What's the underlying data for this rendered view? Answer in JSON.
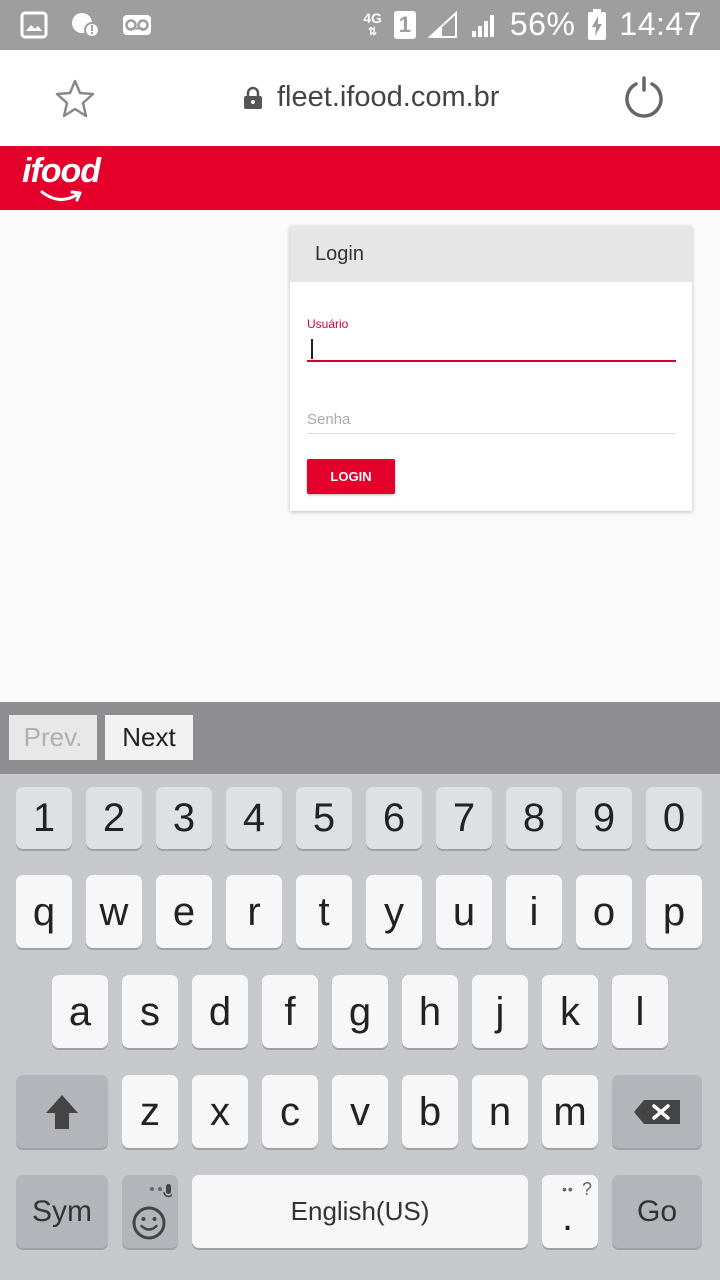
{
  "statusbar": {
    "network_type": "4G",
    "sim_label": "1",
    "battery_percent": "56%",
    "time": "14:47",
    "icons": [
      "image-notification-icon",
      "chat-alert-icon",
      "voicemail-icon",
      "signal-icon",
      "battery-charging-icon"
    ]
  },
  "browser": {
    "url": "fleet.ifood.com.br"
  },
  "brand": {
    "logo_text": "ifood",
    "color": "#e4002b"
  },
  "login": {
    "title": "Login",
    "username_label": "Usuário",
    "username_value": "",
    "password_placeholder": "Senha",
    "button_label": "LOGIN"
  },
  "form_nav": {
    "prev_label": "Prev.",
    "next_label": "Next"
  },
  "keyboard": {
    "row_numbers": [
      "1",
      "2",
      "3",
      "4",
      "5",
      "6",
      "7",
      "8",
      "9",
      "0"
    ],
    "row1": [
      "q",
      "w",
      "e",
      "r",
      "t",
      "y",
      "u",
      "i",
      "o",
      "p"
    ],
    "row2": [
      "a",
      "s",
      "d",
      "f",
      "g",
      "h",
      "j",
      "k",
      "l"
    ],
    "row3": [
      "z",
      "x",
      "c",
      "v",
      "b",
      "n",
      "m"
    ],
    "sym_label": "Sym",
    "space_label": "English(US)",
    "go_label": "Go",
    "punct_label": ".",
    "punct_hint": "?"
  }
}
